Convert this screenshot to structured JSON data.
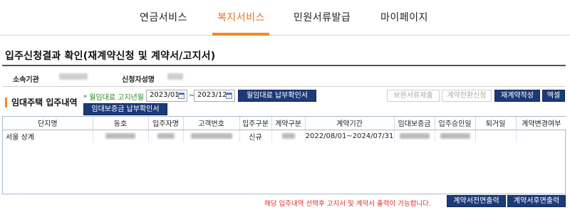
{
  "nav": {
    "items": [
      "연금서비스",
      "복지서비스",
      "민원서류발급",
      "마이페이지"
    ],
    "active_index": 1,
    "accent_color": "#f08a24"
  },
  "page": {
    "title": "입주신청결과 확인(재계약신청 및 계약서/고지서)"
  },
  "info": {
    "org_label": "소속기관",
    "applicant_label": "신청자성명"
  },
  "section": {
    "title": "임대주택 입주내역"
  },
  "filter": {
    "label": "* 월임대료 고지년월",
    "from_date": "2023/01",
    "to_date": "2023/12",
    "separator": "~",
    "monthly_rent_button": "월임대료 납부확인서",
    "deposit_button": "임대보증금 납부확인서"
  },
  "actions": {
    "supplement_submit": "보완서류제출",
    "contract_convert": "계약전환신청",
    "contract_create": "재계약작성",
    "excel": "엑셀"
  },
  "table": {
    "headers": [
      "단지명",
      "동호",
      "입주자명",
      "고객번호",
      "입주구분",
      "계약구분",
      "계약기간",
      "임대보증금",
      "입주승인일",
      "퇴거일",
      "계약변경여부"
    ],
    "rows": [
      {
        "complex": "서울 상계",
        "move_in_type": "신규",
        "contract_period": "2022/08/01~2024/07/31"
      }
    ]
  },
  "footer": {
    "notice": "해당 입주내역 선택후 고지서 및 계약서 출력이 가능합니다.",
    "print_before": "계약서전면출력",
    "print_after": "계약서후면출력"
  }
}
